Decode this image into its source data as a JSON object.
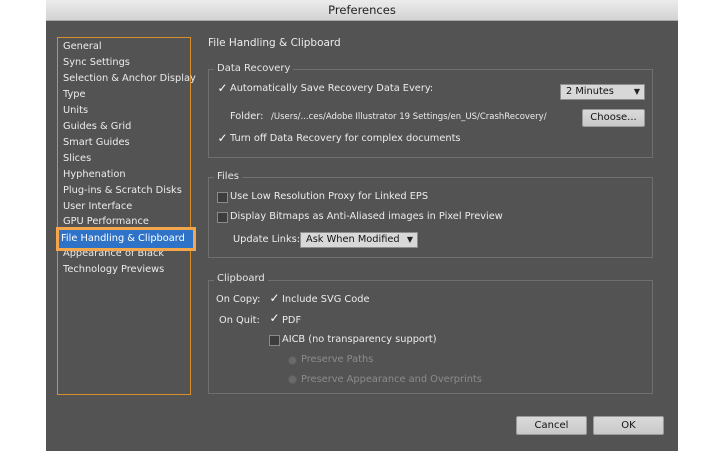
{
  "window": {
    "title": "Preferences"
  },
  "sidebar": {
    "items": [
      {
        "label": "General"
      },
      {
        "label": "Sync Settings"
      },
      {
        "label": "Selection & Anchor Display"
      },
      {
        "label": "Type"
      },
      {
        "label": "Units"
      },
      {
        "label": "Guides & Grid"
      },
      {
        "label": "Smart Guides"
      },
      {
        "label": "Slices"
      },
      {
        "label": "Hyphenation"
      },
      {
        "label": "Plug-ins & Scratch Disks"
      },
      {
        "label": "User Interface"
      },
      {
        "label": "GPU Performance"
      },
      {
        "label": "File Handling & Clipboard",
        "selected": true
      },
      {
        "label": "Appearance of Black"
      },
      {
        "label": "Technology Previews"
      }
    ]
  },
  "main": {
    "section_title": "File Handling & Clipboard",
    "data_recovery": {
      "title": "Data Recovery",
      "auto_save_label": "Automatically Save Recovery Data Every:",
      "auto_save_checked": true,
      "interval_value": "2 Minutes",
      "folder_label": "Folder:",
      "folder_path": "/Users/...ces/Adobe Illustrator 19 Settings/en_US/CrashRecovery/",
      "choose_label": "Choose...",
      "turn_off_label": "Turn off Data Recovery for complex documents",
      "turn_off_checked": true
    },
    "files": {
      "title": "Files",
      "low_res_label": "Use Low Resolution Proxy for Linked EPS",
      "low_res_checked": false,
      "bitmaps_label": "Display Bitmaps as Anti-Aliased images in Pixel Preview",
      "bitmaps_checked": false,
      "update_links_label": "Update Links:",
      "update_links_value": "Ask When Modified"
    },
    "clipboard": {
      "title": "Clipboard",
      "on_copy_label": "On Copy:",
      "include_svg_label": "Include SVG Code",
      "include_svg_checked": true,
      "on_quit_label": "On Quit:",
      "pdf_label": "PDF",
      "pdf_checked": true,
      "aicb_label": "AICB (no transparency support)",
      "aicb_checked": false,
      "preserve_paths_label": "Preserve Paths",
      "preserve_appearance_label": "Preserve Appearance and Overprints"
    }
  },
  "footer": {
    "cancel_label": "Cancel",
    "ok_label": "OK"
  },
  "icons": {
    "checkmark": "✓",
    "dropdown": "▼"
  }
}
